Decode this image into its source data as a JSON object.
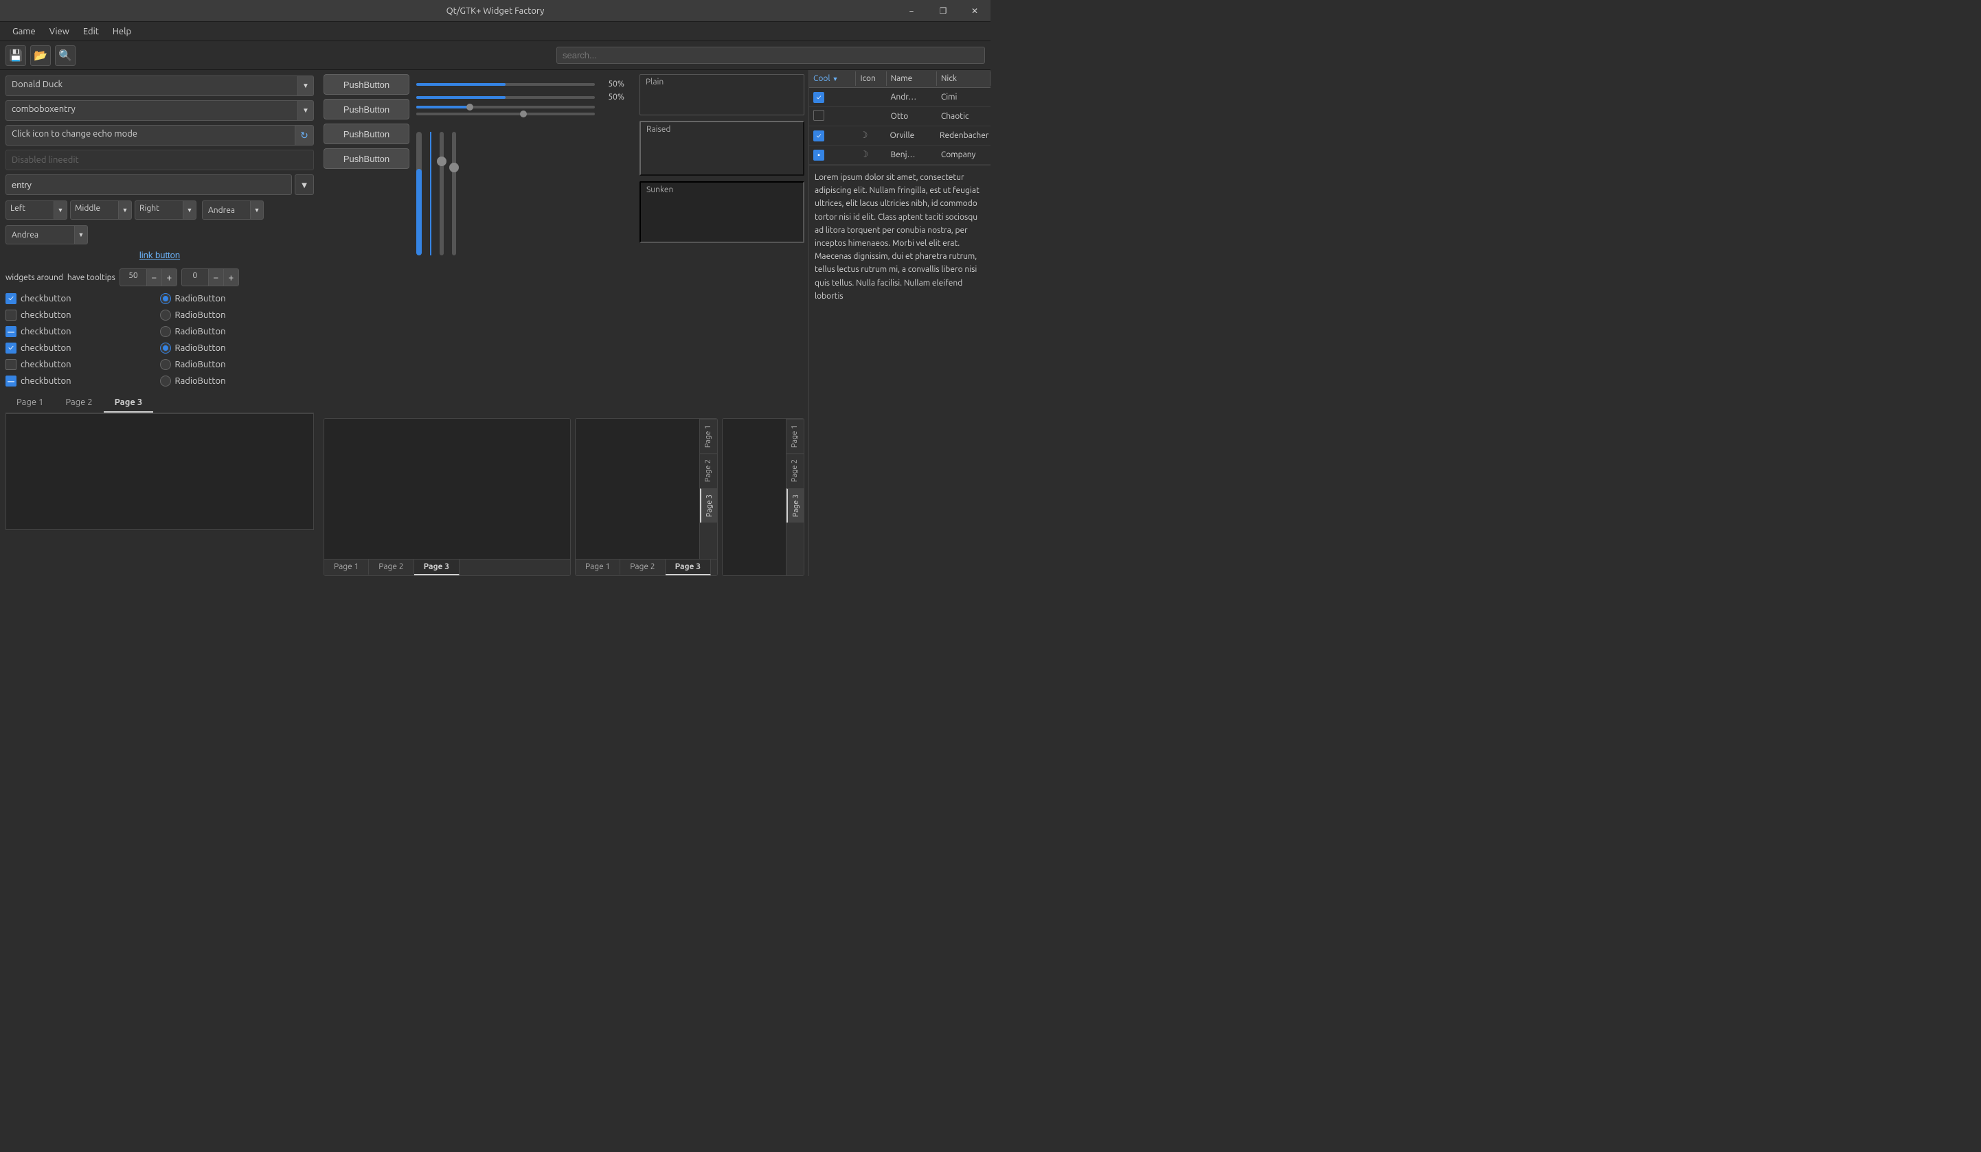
{
  "window": {
    "title": "Qt/GTK+ Widget Factory",
    "min_label": "−",
    "max_label": "❐",
    "close_label": "✕"
  },
  "menubar": {
    "items": [
      "Game",
      "View",
      "Edit",
      "Help"
    ]
  },
  "toolbar": {
    "buttons": [
      {
        "name": "save-icon",
        "icon": "💾"
      },
      {
        "name": "open-icon",
        "icon": "📂"
      },
      {
        "name": "search-icon",
        "icon": "🔍"
      }
    ]
  },
  "search": {
    "placeholder": "search..."
  },
  "combo1": {
    "value": "Donald Duck",
    "arrow": "▼"
  },
  "combo2": {
    "value": "comboboxentry",
    "arrow": "▼"
  },
  "echo": {
    "label": "Click icon to change echo mode",
    "icon": "↻"
  },
  "disabled_input": {
    "placeholder": "Disabled lineedit"
  },
  "entry": {
    "value": "entry"
  },
  "dropdowns": {
    "left": {
      "value": "Left",
      "arrow": "▼"
    },
    "middle": {
      "value": "Middle",
      "arrow": "▼"
    },
    "right": {
      "value": "Right",
      "arrow": "▼"
    }
  },
  "combo_andrea1": {
    "value": "Andrea",
    "arrow": "▼"
  },
  "combo_andrea2": {
    "value": "Andrea",
    "arrow": "▼"
  },
  "link_button": {
    "label": "link button"
  },
  "spinners": {
    "label": "widgets around",
    "tooltip_label": "have tooltips",
    "val1": "50",
    "val2": "0"
  },
  "checkboxes": [
    {
      "checked": true,
      "label": "checkbutton",
      "radio_checked": true,
      "radio_label": "RadioButton"
    },
    {
      "checked": false,
      "label": "checkbutton",
      "radio_checked": false,
      "radio_label": "RadioButton"
    },
    {
      "checked": "indeterminate",
      "label": "checkbutton",
      "radio_checked": false,
      "radio_label": "RadioButton"
    },
    {
      "checked": true,
      "label": "checkbutton",
      "radio_checked": true,
      "radio_label": "RadioButton"
    },
    {
      "checked": false,
      "label": "checkbutton",
      "radio_checked": false,
      "radio_label": "RadioButton"
    },
    {
      "checked": "indeterminate",
      "label": "checkbutton",
      "radio_checked": false,
      "radio_label": "RadioButton"
    }
  ],
  "tabs_main": {
    "items": [
      "Page 1",
      "Page 2",
      "Page 3"
    ],
    "active": 2
  },
  "pushbuttons": [
    "PushButton",
    "PushButton",
    "PushButton",
    "PushButton"
  ],
  "sliders_h": [
    {
      "pct": 50,
      "label": "50%"
    },
    {
      "pct": 50,
      "label": "50%"
    },
    {
      "pct": 30,
      "label": ""
    },
    {
      "pct": 60,
      "label": ""
    }
  ],
  "frames": [
    {
      "label": "Plain",
      "style": "plain"
    },
    {
      "label": "Raised",
      "style": "raised"
    },
    {
      "label": "Sunken",
      "style": "sunken"
    }
  ],
  "table": {
    "headers": [
      {
        "label": "Cool",
        "sorted": true,
        "icon": "▼"
      },
      {
        "label": "Icon"
      },
      {
        "label": "Name"
      },
      {
        "label": "Nick"
      }
    ],
    "rows": [
      {
        "cool_checked": true,
        "cool_partial": false,
        "has_icon": false,
        "name": "Andr…",
        "nick": "Cimi"
      },
      {
        "cool_checked": false,
        "cool_partial": false,
        "has_icon": false,
        "name": "Otto",
        "nick": "Chaotic"
      },
      {
        "cool_checked": true,
        "cool_partial": false,
        "has_icon": true,
        "name": "Orville",
        "nick": "Redenbacher"
      },
      {
        "cool_checked": true,
        "cool_partial": true,
        "has_icon": true,
        "name": "Benj…",
        "nick": "Company"
      }
    ]
  },
  "lorem_text": "Lorem ipsum dolor sit amet, consectetur adipiscing elit.\nNullam fringilla, est ut feugiat ultrices, elit lacus ultricies nibh, id commodo tortor nisi id elit.\nClass aptent taciti sociosqu ad litora torquent per conubia nostra, per inceptos himenaeos.\nMorbi vel elit erat. Maecenas dignissim, dui et pharetra rutrum, tellus lectus rutrum mi, a convallis libero nisi quis tellus.\nNulla facilisi. Nullam eleifend lobortis",
  "bottom_notebooks": {
    "main_tabs": [
      "Page 1",
      "Page 2",
      "Page 3"
    ],
    "main_active": 2,
    "vtabs1": [
      "Page 1",
      "Page 2",
      "Page 3"
    ],
    "vtabs1_active": 2,
    "bottom_htabs1": [
      "Page 1",
      "Page 2",
      "Page 3"
    ],
    "bottom_htabs1_active": 2,
    "vtabs2": [
      "Page 1",
      "Page 2",
      "Page 3"
    ],
    "vtabs2_active": 2
  }
}
